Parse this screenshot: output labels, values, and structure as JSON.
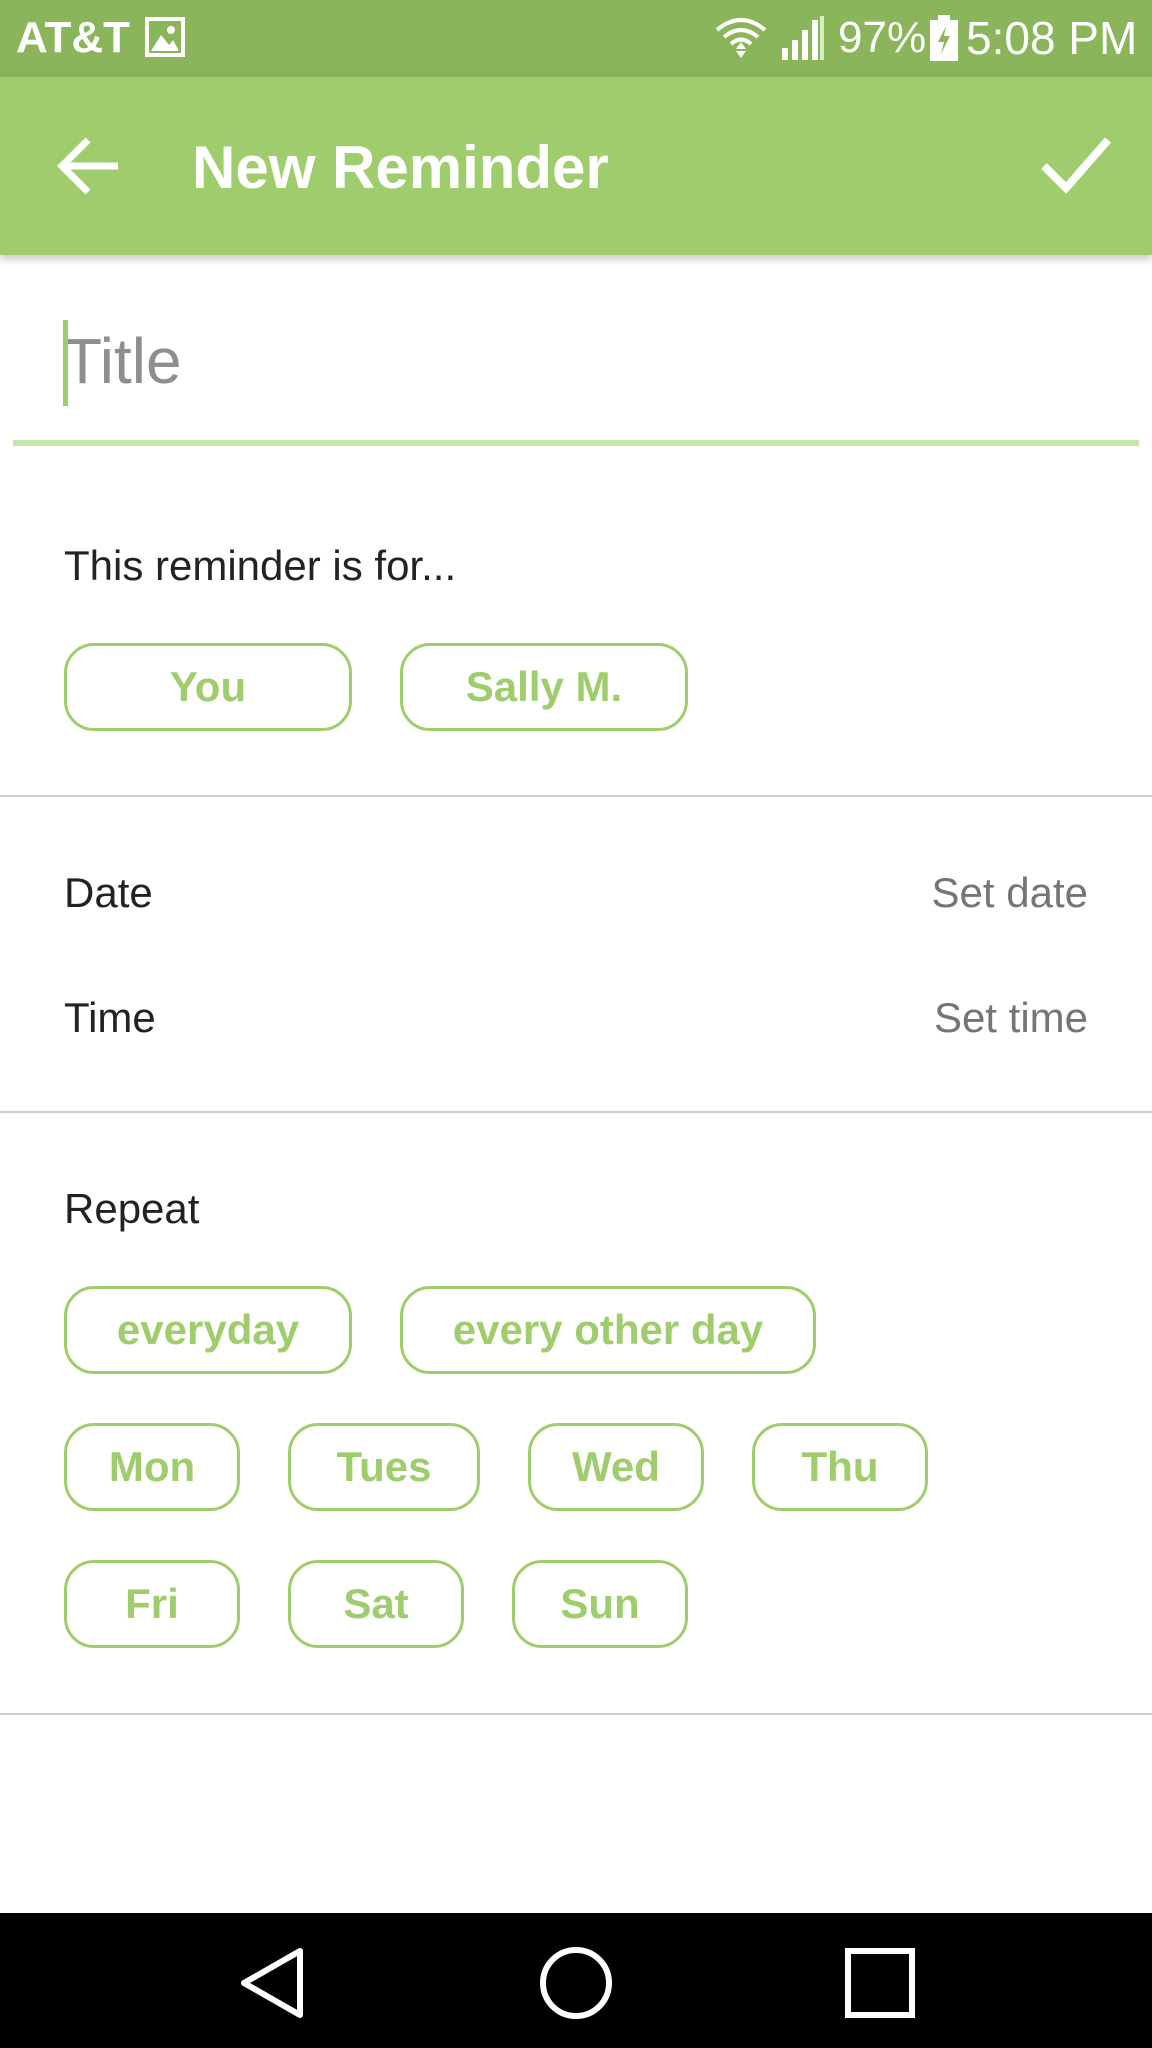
{
  "status_bar": {
    "carrier": "AT&T",
    "battery": "97%",
    "time": "5:08 PM",
    "icons": [
      "gallery-icon",
      "wifi-icon",
      "signal-icon",
      "battery-charging-icon"
    ]
  },
  "app_bar": {
    "title": "New Reminder",
    "back_icon": "arrow-back-icon",
    "confirm_icon": "check-icon"
  },
  "title_field": {
    "placeholder": "Title",
    "value": ""
  },
  "recipient": {
    "label": "This reminder is for...",
    "options": [
      "You",
      "Sally M."
    ]
  },
  "schedule": {
    "date_label": "Date",
    "date_value": "Set date",
    "time_label": "Time",
    "time_value": "Set time"
  },
  "repeat": {
    "label": "Repeat",
    "frequency_options": [
      "everyday",
      "every other day"
    ],
    "days": [
      "Mon",
      "Tues",
      "Wed",
      "Thu",
      "Fri",
      "Sat",
      "Sun"
    ]
  },
  "colors": {
    "status_bar": "#8ab55a",
    "app_bar": "#9fcd6d",
    "accent": "#9fcd6d",
    "underline": "#c5e7a6",
    "nav_bar": "#000000"
  },
  "nav_bar": {
    "icons": [
      "back-triangle-icon",
      "home-circle-icon",
      "recents-square-icon"
    ]
  }
}
